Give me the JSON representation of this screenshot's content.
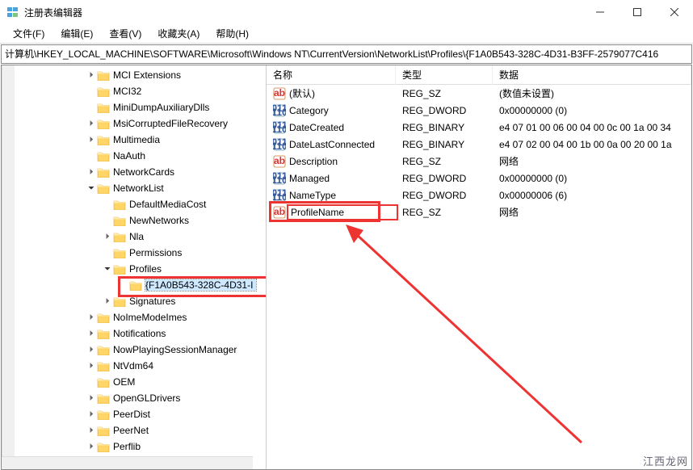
{
  "window": {
    "title": "注册表编辑器"
  },
  "menu": {
    "file": "文件(F)",
    "edit": "编辑(E)",
    "view": "查看(V)",
    "favorites": "收藏夹(A)",
    "help": "帮助(H)"
  },
  "address": "计算机\\HKEY_LOCAL_MACHINE\\SOFTWARE\\Microsoft\\Windows NT\\CurrentVersion\\NetworkList\\Profiles\\{F1A0B543-328C-4D31-B3FF-2579077C416",
  "tree": [
    {
      "label": "MCI Extensions",
      "indent": 104,
      "chev": "closed"
    },
    {
      "label": "MCI32",
      "indent": 104,
      "chev": "none"
    },
    {
      "label": "MiniDumpAuxiliaryDlls",
      "indent": 104,
      "chev": "none"
    },
    {
      "label": "MsiCorruptedFileRecovery",
      "indent": 104,
      "chev": "closed"
    },
    {
      "label": "Multimedia",
      "indent": 104,
      "chev": "closed"
    },
    {
      "label": "NaAuth",
      "indent": 104,
      "chev": "none"
    },
    {
      "label": "NetworkCards",
      "indent": 104,
      "chev": "closed"
    },
    {
      "label": "NetworkList",
      "indent": 104,
      "chev": "open"
    },
    {
      "label": "DefaultMediaCost",
      "indent": 124,
      "chev": "none"
    },
    {
      "label": "NewNetworks",
      "indent": 124,
      "chev": "none"
    },
    {
      "label": "Nla",
      "indent": 124,
      "chev": "closed"
    },
    {
      "label": "Permissions",
      "indent": 124,
      "chev": "none"
    },
    {
      "label": "Profiles",
      "indent": 124,
      "chev": "open"
    },
    {
      "label": "{F1A0B543-328C-4D31-I",
      "indent": 144,
      "chev": "none",
      "selected": true
    },
    {
      "label": "Signatures",
      "indent": 124,
      "chev": "closed"
    },
    {
      "label": "NoImeModeImes",
      "indent": 104,
      "chev": "closed"
    },
    {
      "label": "Notifications",
      "indent": 104,
      "chev": "closed"
    },
    {
      "label": "NowPlayingSessionManager",
      "indent": 104,
      "chev": "closed"
    },
    {
      "label": "NtVdm64",
      "indent": 104,
      "chev": "closed"
    },
    {
      "label": "OEM",
      "indent": 104,
      "chev": "none"
    },
    {
      "label": "OpenGLDrivers",
      "indent": 104,
      "chev": "closed"
    },
    {
      "label": "PeerDist",
      "indent": 104,
      "chev": "closed"
    },
    {
      "label": "PeerNet",
      "indent": 104,
      "chev": "closed"
    },
    {
      "label": "Perflib",
      "indent": 104,
      "chev": "closed"
    }
  ],
  "columns": {
    "name": "名称",
    "type": "类型",
    "data": "数据"
  },
  "values": [
    {
      "name": "(默认)",
      "type": "REG_SZ",
      "data": "(数值未设置)",
      "icon": "ab"
    },
    {
      "name": "Category",
      "type": "REG_DWORD",
      "data": "0x00000000 (0)",
      "icon": "bin"
    },
    {
      "name": "DateCreated",
      "type": "REG_BINARY",
      "data": "e4 07 01 00 06 00 04 00 0c 00 1a 00 34",
      "icon": "bin"
    },
    {
      "name": "DateLastConnected",
      "type": "REG_BINARY",
      "data": "e4 07 02 00 04 00 1b 00 0a 00 20 00 1a",
      "icon": "bin"
    },
    {
      "name": "Description",
      "type": "REG_SZ",
      "data": "网络",
      "icon": "ab"
    },
    {
      "name": "Managed",
      "type": "REG_DWORD",
      "data": "0x00000000 (0)",
      "icon": "bin"
    },
    {
      "name": "NameType",
      "type": "REG_DWORD",
      "data": "0x00000006 (6)",
      "icon": "bin"
    },
    {
      "name": "ProfileName",
      "type": "REG_SZ",
      "data": "网络",
      "icon": "ab",
      "highlight": true
    }
  ],
  "watermark": "江西龙网"
}
